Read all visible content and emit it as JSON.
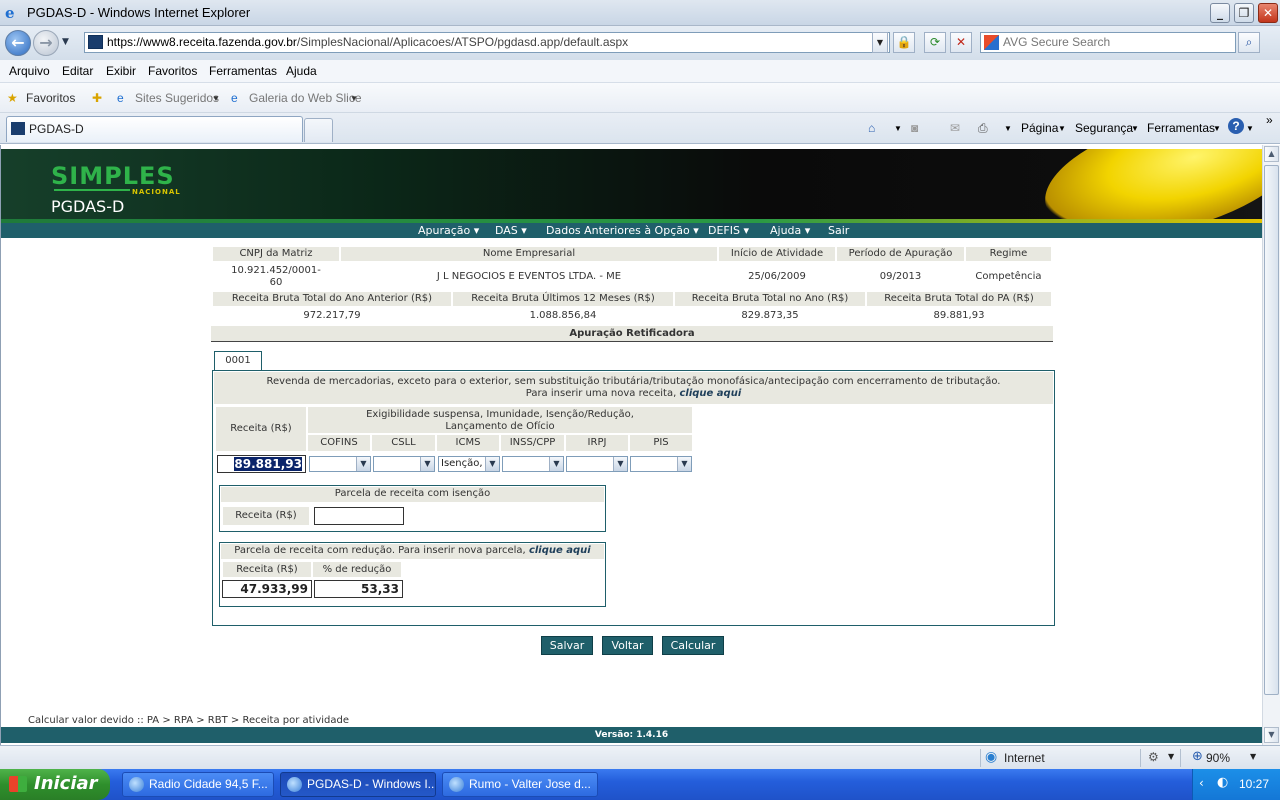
{
  "window": {
    "title": "PGDAS-D - Windows Internet Explorer"
  },
  "address": {
    "prefix": "https://www8.receita.",
    "domain": "fazenda.gov.br",
    "path": "/SimplesNacional/Aplicacoes/ATSPO/pgdasd.app/default.aspx",
    "search_placeholder": "AVG Secure Search"
  },
  "menubar": [
    "Arquivo",
    "Editar",
    "Exibir",
    "Favoritos",
    "Ferramentas",
    "Ajuda"
  ],
  "favorites": {
    "label": "Favoritos",
    "sites": "Sites Sugeridos",
    "gallery": "Galeria do Web Slice"
  },
  "tabs": {
    "active": "PGDAS-D"
  },
  "commandbar": {
    "pagina": "Página",
    "seguranca": "Segurança",
    "ferramentas": "Ferramentas"
  },
  "site": {
    "logo": "SIMPLES",
    "logo_sub": "NACIONAL",
    "title": "PGDAS-D",
    "nav": [
      "Apuração",
      "DAS",
      "Dados Anteriores à Opção",
      "DEFIS",
      "Ajuda",
      "Sair"
    ]
  },
  "info": {
    "headers1": [
      "CNPJ da Matriz",
      "Nome Empresarial",
      "Início de Atividade",
      "Período de Apuração",
      "Regime"
    ],
    "cnpj_line1": "10.921.452/0001-",
    "cnpj_line2": "60",
    "nome": "J L NEGOCIOS E EVENTOS LTDA. - ME",
    "inicio": "25/06/2009",
    "periodo": "09/2013",
    "regime": "Competência",
    "headers2": [
      "Receita Bruta Total do Ano Anterior (R$)",
      "Receita Bruta Últimos 12 Meses (R$)",
      "Receita Bruta Total no Ano (R$)",
      "Receita Bruta Total do PA (R$)"
    ],
    "values2": [
      "972.217,79",
      "1.088.856,84",
      "829.873,35",
      "89.881,93"
    ]
  },
  "section_title": "Apuração Retificadora",
  "form_tab": "0001",
  "activity": {
    "description": "Revenda de mercadorias, exceto para o exterior, sem substituição tributária/tributação monofásica/antecipação com encerramento de tributação.",
    "new_line_text": "Para inserir uma nova receita,",
    "new_line_link": "clique aqui",
    "receita_label": "Receita (R$)",
    "exig_line1": "Exigibilidade suspensa, Imunidade, Isenção/Redução,",
    "exig_line2": "Lançamento de Ofício",
    "taxes": [
      "COFINS",
      "CSLL",
      "ICMS",
      "INSS/CPP",
      "IRPJ",
      "PIS"
    ],
    "receita_value": "89.881,93",
    "icms_value": "Isenção,"
  },
  "isencao": {
    "title": "Parcela de receita com isenção",
    "receita_label": "Receita (R$)",
    "value": ""
  },
  "reducao": {
    "title": "Parcela de receita com redução. Para inserir nova parcela,",
    "link": "clique aqui",
    "receita_label": "Receita (R$)",
    "pct_label": "% de redução",
    "receita_value": "47.933,99",
    "pct_value": "53,33"
  },
  "buttons": {
    "salvar": "Salvar",
    "voltar": "Voltar",
    "calcular": "Calcular"
  },
  "breadcrumb": "Calcular valor devido :: PA > RPA > RBT > Receita por atividade",
  "version": "Versão: 1.4.16",
  "status": {
    "zone": "Internet",
    "zoom": "90%"
  },
  "taskbar": {
    "start": "Iniciar",
    "items": [
      "Radio Cidade 94,5 F...",
      "PGDAS-D - Windows I...",
      "Rumo - Valter Jose d..."
    ],
    "clock": "10:27"
  }
}
